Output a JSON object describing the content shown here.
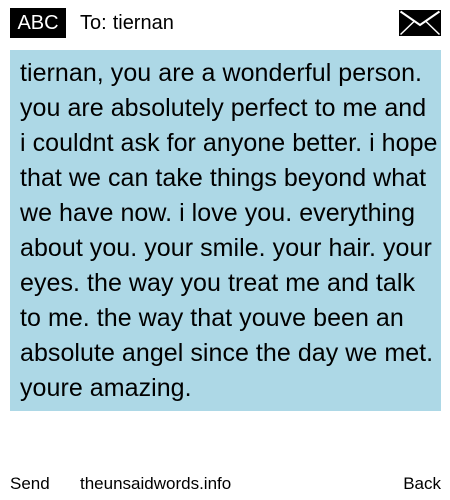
{
  "header": {
    "mode_label": "ABC",
    "to_prefix": "To:",
    "recipient": "tiernan",
    "envelope_icon": "envelope-icon"
  },
  "message": {
    "text": "tiernan, you are a wonderful person. you are absolutely perfect to me and i couldnt ask for anyone better. i hope that we can take things beyond what we have now. i love you. everything about you. your smile. your hair. your eyes. the way you treat me and talk to me. the way that youve been an absolute angel since the day we met. youre amazing."
  },
  "footer": {
    "send_label": "Send",
    "site": "theunsaidwords.info",
    "back_label": "Back"
  },
  "colors": {
    "message_background": "#add8e6",
    "badge_background": "#000000",
    "page_background": "#ffffff"
  }
}
